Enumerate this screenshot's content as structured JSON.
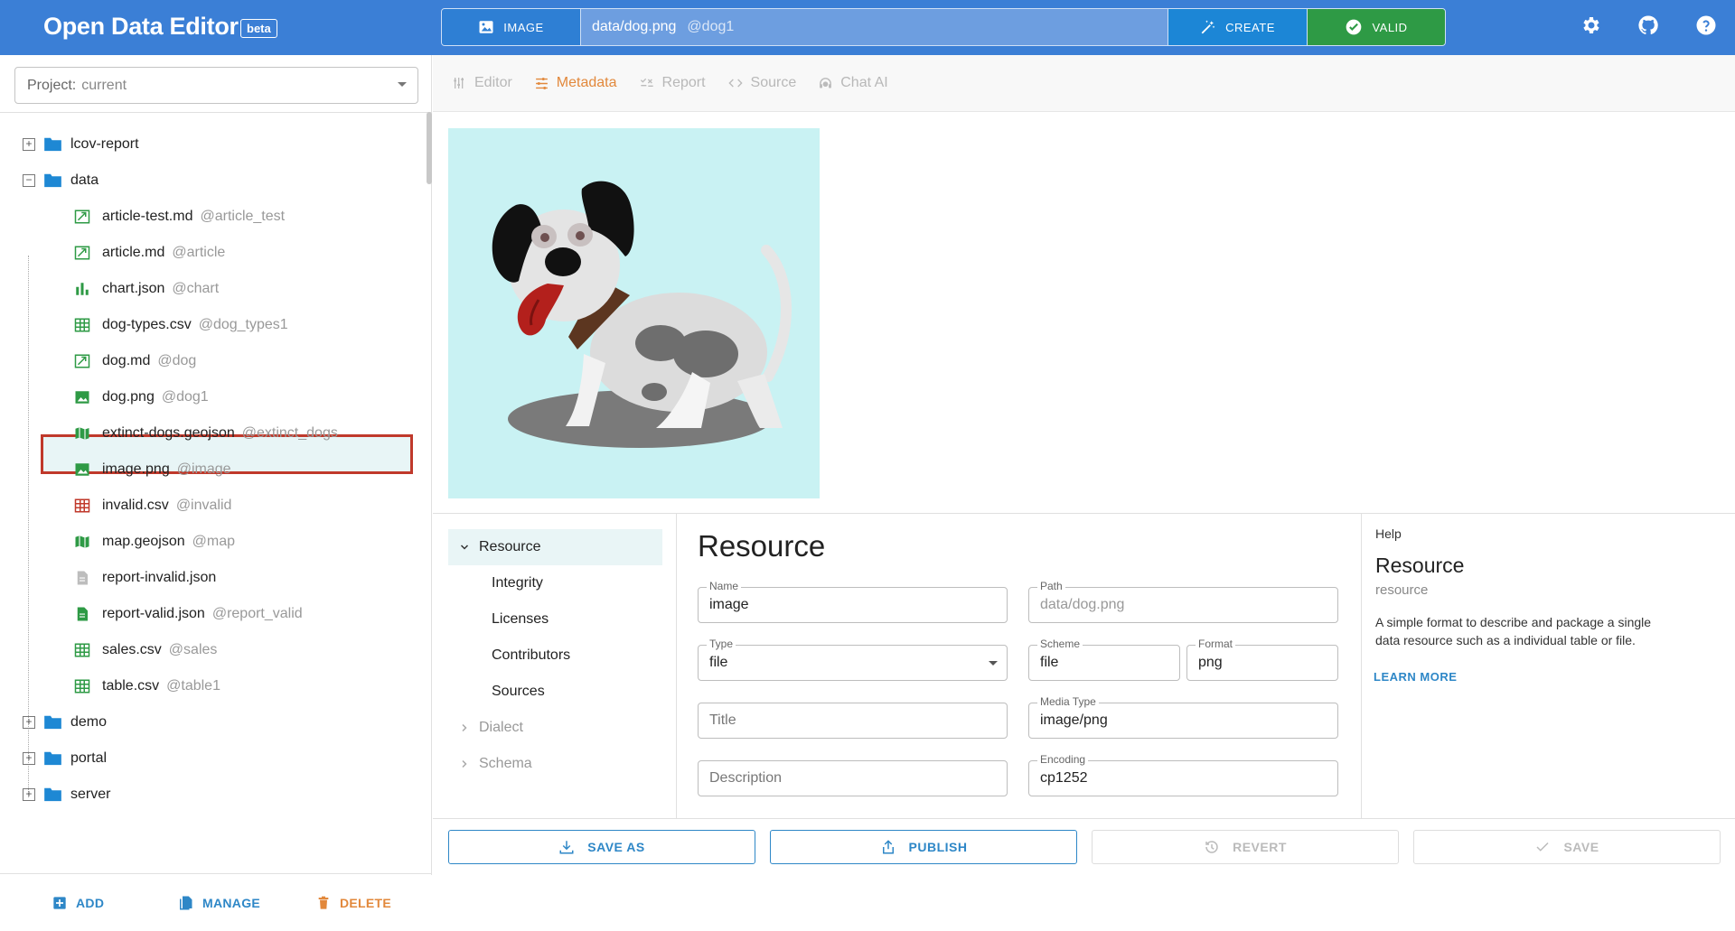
{
  "header": {
    "title": "Open Data Editor",
    "badge": "beta",
    "image_button": "IMAGE",
    "path": "data/dog.png",
    "path_alias": "@dog1",
    "create_button": "CREATE",
    "valid_button": "VALID",
    "icons": [
      "gear-icon",
      "github-icon",
      "help-icon"
    ]
  },
  "sidebar": {
    "project_label": "Project:",
    "project_value": "current",
    "tree": [
      {
        "name": "lcov-report",
        "alias": "",
        "kind": "folder",
        "state": "collapsed"
      },
      {
        "name": "data",
        "alias": "",
        "kind": "folder",
        "state": "expanded"
      },
      {
        "name": "article-test.md",
        "alias": "@article_test",
        "kind": "text"
      },
      {
        "name": "article.md",
        "alias": "@article",
        "kind": "text"
      },
      {
        "name": "chart.json",
        "alias": "@chart",
        "kind": "chart"
      },
      {
        "name": "dog-types.csv",
        "alias": "@dog_types1",
        "kind": "table"
      },
      {
        "name": "dog.md",
        "alias": "@dog",
        "kind": "text"
      },
      {
        "name": "dog.png",
        "alias": "@dog1",
        "kind": "image",
        "selected": true
      },
      {
        "name": "extinct-dogs.geojson",
        "alias": "@extinct_dogs",
        "kind": "map"
      },
      {
        "name": "image.png",
        "alias": "@image",
        "kind": "image"
      },
      {
        "name": "invalid.csv",
        "alias": "@invalid",
        "kind": "table-invalid"
      },
      {
        "name": "map.geojson",
        "alias": "@map",
        "kind": "map"
      },
      {
        "name": "report-invalid.json",
        "alias": "",
        "kind": "file-grey"
      },
      {
        "name": "report-valid.json",
        "alias": "@report_valid",
        "kind": "file-green"
      },
      {
        "name": "sales.csv",
        "alias": "@sales",
        "kind": "table"
      },
      {
        "name": "table.csv",
        "alias": "@table1",
        "kind": "table"
      },
      {
        "name": "demo",
        "alias": "",
        "kind": "folder",
        "state": "collapsed"
      },
      {
        "name": "portal",
        "alias": "",
        "kind": "folder",
        "state": "collapsed"
      },
      {
        "name": "server",
        "alias": "",
        "kind": "folder",
        "state": "collapsed"
      }
    ],
    "footer": {
      "add": "ADD",
      "manage": "MANAGE",
      "delete": "DELETE"
    }
  },
  "tabs": [
    {
      "label": "Editor",
      "active": false
    },
    {
      "label": "Metadata",
      "active": true
    },
    {
      "label": "Report",
      "active": false
    },
    {
      "label": "Source",
      "active": false
    },
    {
      "label": "Chat AI",
      "active": false
    }
  ],
  "meta_nav": {
    "resource": "Resource",
    "integrity": "Integrity",
    "licenses": "Licenses",
    "contributors": "Contributors",
    "sources": "Sources",
    "dialect": "Dialect",
    "schema": "Schema"
  },
  "form": {
    "title": "Resource",
    "name": {
      "label": "Name",
      "value": "image"
    },
    "path": {
      "label": "Path",
      "value": "data/dog.png"
    },
    "type": {
      "label": "Type",
      "value": "file"
    },
    "scheme": {
      "label": "Scheme",
      "value": "file"
    },
    "format": {
      "label": "Format",
      "value": "png"
    },
    "title_field": {
      "placeholder": "Title"
    },
    "media_type": {
      "label": "Media Type",
      "value": "image/png"
    },
    "description": {
      "placeholder": "Description"
    },
    "encoding": {
      "label": "Encoding",
      "value": "cp1252"
    }
  },
  "help": {
    "label": "Help",
    "title": "Resource",
    "subtitle": "resource",
    "text": "A simple format to describe and package a single data resource such as a individual table or file.",
    "link": "LEARN MORE"
  },
  "footer": {
    "save_as": "SAVE AS",
    "publish": "PUBLISH",
    "revert": "REVERT",
    "save": "SAVE"
  },
  "colors": {
    "header": "#3b7fd6",
    "accent_orange": "#e2883b",
    "valid_green": "#2e9a45",
    "link_blue": "#2e87c7",
    "selection_red": "#c0392b"
  }
}
